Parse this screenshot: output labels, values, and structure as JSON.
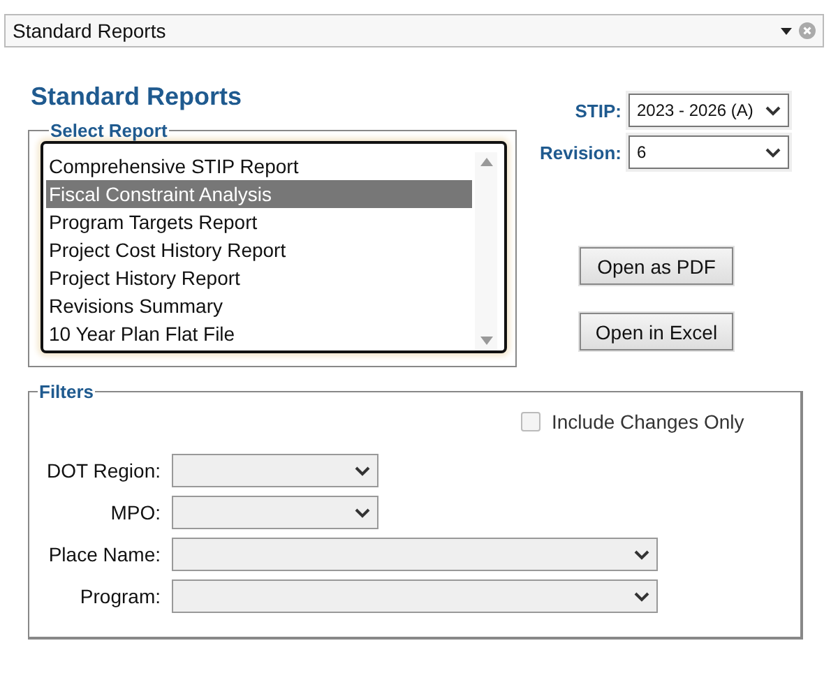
{
  "header_combo": {
    "value": "Standard Reports"
  },
  "title": "Standard Reports",
  "select_report": {
    "legend": "Select Report",
    "items": [
      {
        "label": "Comprehensive STIP Report",
        "selected": false
      },
      {
        "label": "Fiscal Constraint Analysis",
        "selected": true
      },
      {
        "label": "Program Targets Report",
        "selected": false
      },
      {
        "label": "Project Cost History Report",
        "selected": false
      },
      {
        "label": "Project History Report",
        "selected": false
      },
      {
        "label": "Revisions Summary",
        "selected": false
      },
      {
        "label": "10 Year Plan Flat File",
        "selected": false
      }
    ]
  },
  "selectors": [
    {
      "label": "STIP:",
      "value": "2023 - 2026 (A)"
    },
    {
      "label": "Revision:",
      "value": "6"
    }
  ],
  "buttons": [
    "Open as PDF",
    "Open in Excel"
  ],
  "filters": {
    "legend": "Filters",
    "include_changes_only": {
      "label": "Include Changes Only",
      "checked": false,
      "disabled": true
    },
    "fields": [
      {
        "label": "DOT Region:",
        "kind": "short"
      },
      {
        "label": "MPO:",
        "kind": "short"
      },
      {
        "label": "Place Name:",
        "kind": "long"
      },
      {
        "label": "Program:",
        "kind": "long"
      }
    ]
  }
}
